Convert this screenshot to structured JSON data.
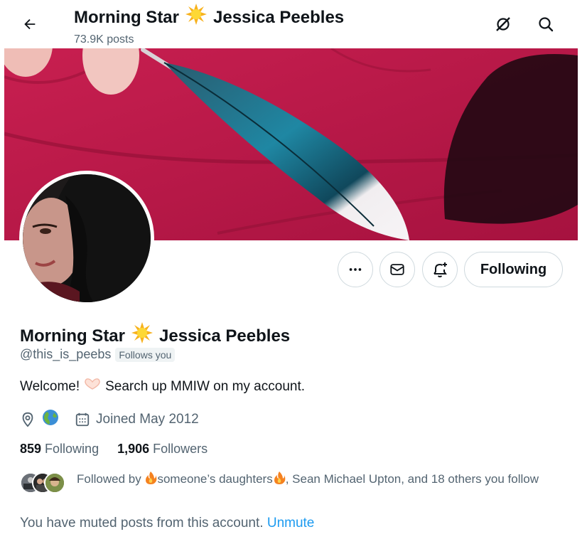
{
  "header": {
    "title_first": "Morning Star",
    "title_last": "Jessica Peebles",
    "post_count": "73.9K posts"
  },
  "profile": {
    "name_first": "Morning Star",
    "name_last": "Jessica Peebles",
    "handle": "@this_is_peebs",
    "follows_you": "Follows you",
    "bio_start": "Welcome!",
    "bio_end": "Search up MMIW on my account.",
    "joined": "Joined May 2012"
  },
  "actions": {
    "following_label": "Following"
  },
  "stats": {
    "following_count": "859",
    "following_label": "Following",
    "followers_count": "1,906",
    "followers_label": "Followers"
  },
  "followed_by": {
    "prefix": "Followed by",
    "name1": "someone’s daughters",
    "rest": ", Sean Michael Upton, and 18 others you follow"
  },
  "muted": {
    "text": "You have muted posts from this account.",
    "action": "Unmute"
  },
  "icons": [
    "back-arrow-icon",
    "sun-emoji-icon",
    "grok-icon",
    "search-icon",
    "more-icon",
    "mail-icon",
    "bell-plus-icon",
    "location-icon",
    "globe-emoji-icon",
    "calendar-icon",
    "heart-hands-emoji-icon",
    "fire-emoji-icon"
  ],
  "colors": {
    "accent": "#1d9bf0",
    "secondary_text": "#536471",
    "banner_bg": "#b8184a"
  }
}
